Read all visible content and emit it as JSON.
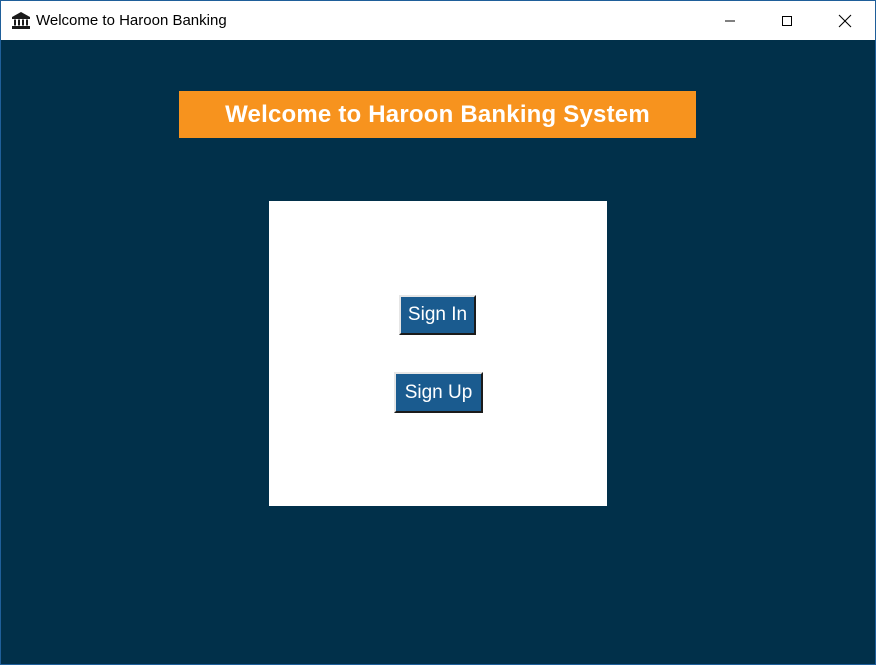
{
  "window": {
    "title": "Welcome to Haroon Banking",
    "icon": "bank-building-icon",
    "controls": [
      "minimize-icon",
      "maximize-icon",
      "close-icon"
    ]
  },
  "main": {
    "banner_text": "Welcome to Haroon Banking System",
    "signin_label": "Sign In",
    "signup_label": "Sign Up"
  },
  "colors": {
    "background": "#01304a",
    "banner": "#f7931e",
    "button": "#1a5b8f",
    "panel": "#ffffff"
  }
}
